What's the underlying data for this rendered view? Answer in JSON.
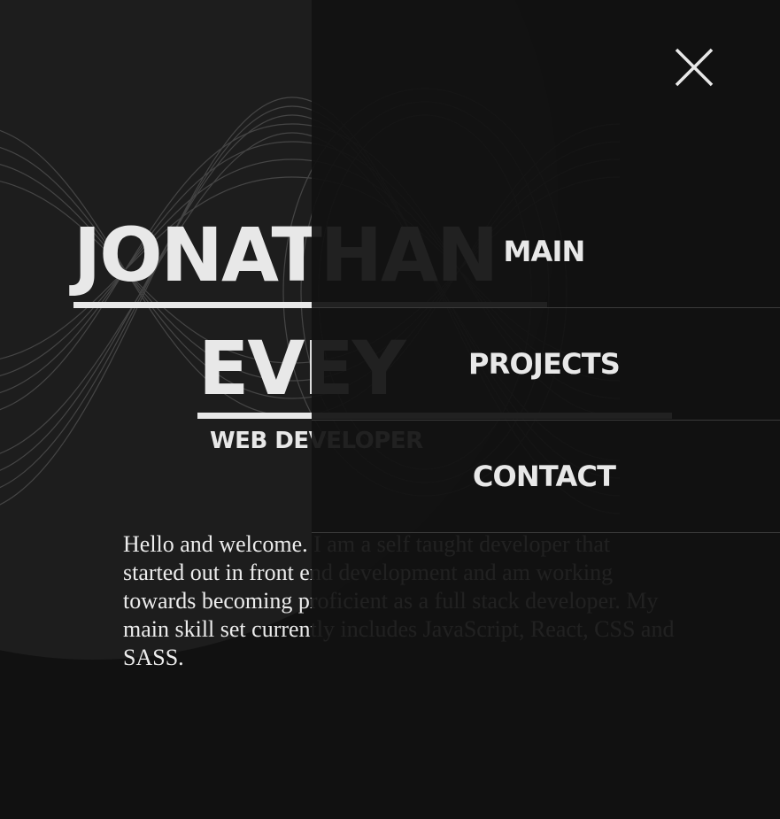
{
  "hero": {
    "name_first": "JONATHAN",
    "name_last": "EVEY",
    "title": "WEB DEVELOPER",
    "intro": "Hello and welcome. I am a self taught developer that started out in front end development and am working towards becoming proficient as a full stack developer. My main skill set currently includes JavaScript, React, CSS and SASS."
  },
  "menu": {
    "close_icon": "close-x-icon",
    "items": [
      {
        "label": "MAIN"
      },
      {
        "label": "PROJECTS"
      },
      {
        "label": "CONTACT"
      }
    ]
  },
  "colors": {
    "background": "#111111",
    "circle": "#1d1d1d",
    "text": "#e8e8e8",
    "divider": "#3a3a3a"
  }
}
